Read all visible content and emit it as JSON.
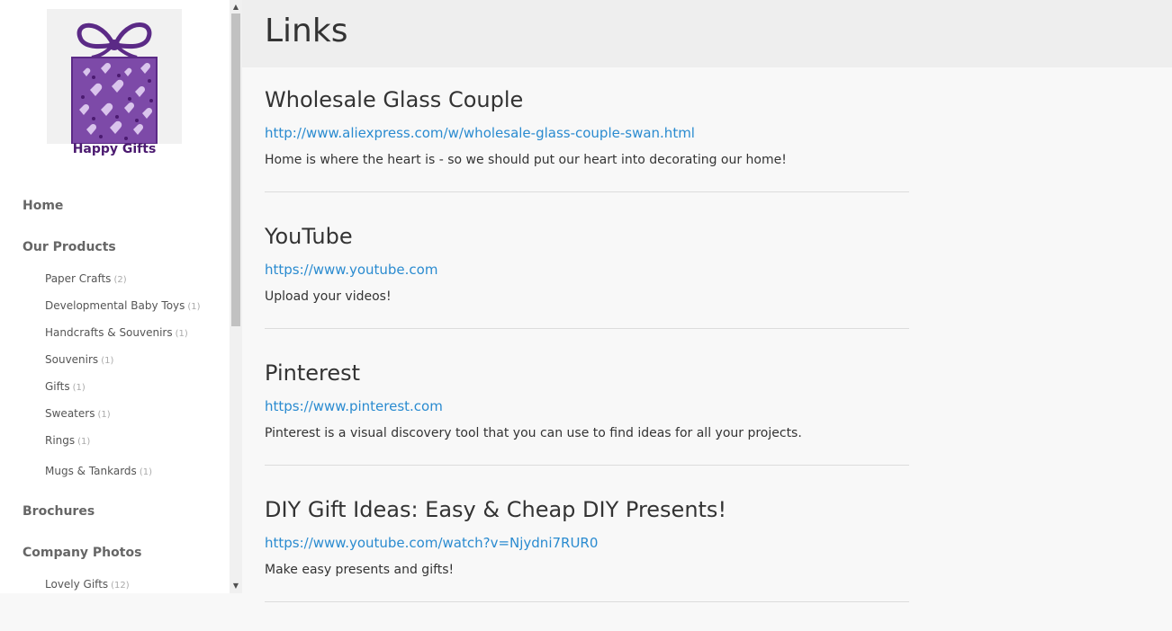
{
  "logo": {
    "text": "Happy Gifts"
  },
  "sidebar": {
    "home": "Home",
    "our_products": "Our Products",
    "product_categories": [
      {
        "label": "Paper Crafts",
        "count": "(2)"
      },
      {
        "label": "Developmental Baby Toys",
        "count": "(1)"
      },
      {
        "label": "Handcrafts & Souvenirs",
        "count": "(1)"
      },
      {
        "label": "Souvenirs",
        "count": "(1)"
      },
      {
        "label": "Gifts",
        "count": "(1)"
      },
      {
        "label": "Sweaters",
        "count": "(1)"
      },
      {
        "label": "Rings",
        "count": "(1)"
      },
      {
        "label": "Mugs & Tankards",
        "count": "(1)"
      }
    ],
    "brochures": "Brochures",
    "company_photos": "Company Photos",
    "photo_categories": [
      {
        "label": "Lovely Gifts",
        "count": "(12)"
      }
    ]
  },
  "page": {
    "title": "Links"
  },
  "links": [
    {
      "title": "Wholesale Glass Couple",
      "url": "http://www.aliexpress.com/w/wholesale-glass-couple-swan.html",
      "description": "Home is where the heart is - so we should put our heart into decorating our home!"
    },
    {
      "title": "YouTube",
      "url": "https://www.youtube.com",
      "description": "Upload your videos!"
    },
    {
      "title": "Pinterest",
      "url": "https://www.pinterest.com",
      "description": "Pinterest is a visual discovery tool that you can use to find ideas for all your projects."
    },
    {
      "title": "DIY Gift Ideas: Easy & Cheap DIY Presents!",
      "url": "https://www.youtube.com/watch?v=Njydni7RUR0",
      "description": "Make easy presents and gifts!"
    }
  ],
  "colors": {
    "link": "#2a8bd0",
    "brand_purple": "#5b2a86"
  },
  "icons": {
    "logo": "gift-box-hearts-icon",
    "scroll_up": "arrow-up-icon",
    "scroll_down": "arrow-down-icon"
  }
}
